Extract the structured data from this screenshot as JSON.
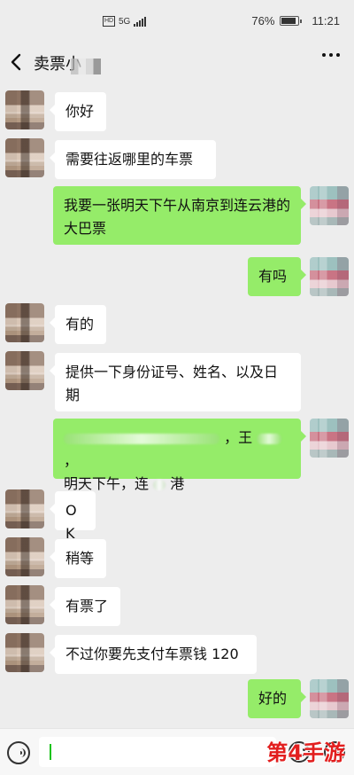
{
  "status_bar": {
    "network": "5G",
    "battery": "76%",
    "time": "11:21"
  },
  "header": {
    "title": "卖票小"
  },
  "messages": [
    {
      "side": "left",
      "text": "你好"
    },
    {
      "side": "left",
      "text": "需要往返哪里的车票"
    },
    {
      "side": "right",
      "text": "我要一张明天下午从南京到连云港的大巴票"
    },
    {
      "side": "right",
      "text": "有吗"
    },
    {
      "side": "left",
      "text": "有的"
    },
    {
      "side": "left",
      "text": "提供一下身份证号、姓名、以及日期"
    },
    {
      "side": "right",
      "text_parts": [
        "，王",
        "，",
        "明天下午，连",
        "港"
      ]
    },
    {
      "side": "left",
      "text": "OK"
    },
    {
      "side": "left",
      "text": "稍等"
    },
    {
      "side": "left",
      "text": "有票了"
    },
    {
      "side": "left",
      "text": "不过你要先支付车票钱 120"
    },
    {
      "side": "right",
      "text": "好的"
    }
  ],
  "watermark": "第4手游",
  "colors": {
    "background": "#ededed",
    "left_bubble": "#ffffff",
    "right_bubble": "#95ec69",
    "watermark": "#e21e1e"
  },
  "icons": {
    "back": "back-icon",
    "more": "more-icon",
    "voice": "voice-icon",
    "emoji": "emoji-icon",
    "plus": "plus-icon"
  }
}
